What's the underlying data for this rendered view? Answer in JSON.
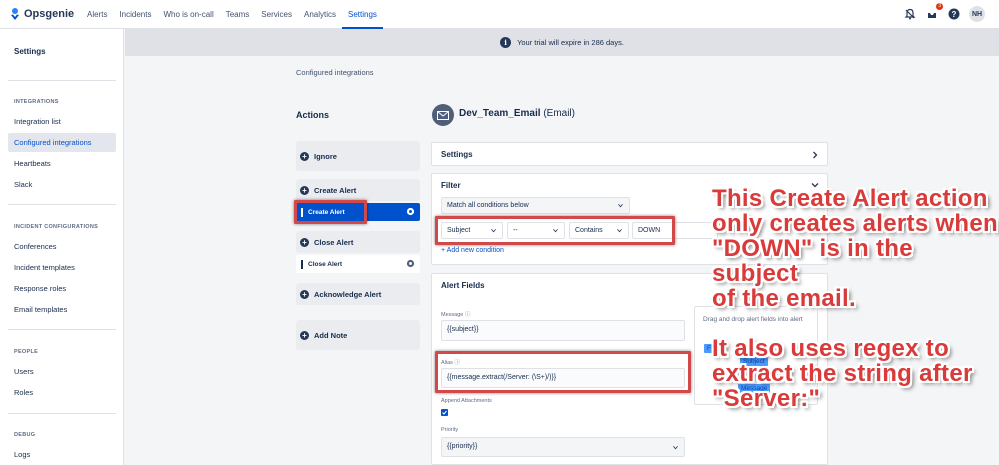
{
  "app": {
    "name": "Opsgenie",
    "brand_color": "#0052cc"
  },
  "nav": [
    "Alerts",
    "Incidents",
    "Who is on-call",
    "Teams",
    "Services",
    "Analytics",
    "Settings"
  ],
  "nav_active": "Settings",
  "topbar": {
    "notification_count": "3",
    "avatar_initials": "NH"
  },
  "sidebar": {
    "title": "Settings",
    "sections": [
      {
        "heading": "INTEGRATIONS",
        "items": [
          "Integration list",
          "Configured integrations",
          "Heartbeats",
          "Slack"
        ]
      },
      {
        "heading": "INCIDENT CONFIGURATIONS",
        "items": [
          "Conferences",
          "Incident templates",
          "Response roles",
          "Email templates"
        ]
      },
      {
        "heading": "PEOPLE",
        "items": [
          "Users",
          "Roles"
        ]
      },
      {
        "heading": "DEBUG",
        "items": [
          "Logs"
        ]
      }
    ],
    "active_item": "Configured integrations"
  },
  "banner": {
    "text": "Your trial will expire in 286 days."
  },
  "breadcrumb": "Configured integrations",
  "actions": {
    "title": "Actions",
    "ignore": "Ignore",
    "create_alert": "Create Alert",
    "create_alert_rule": "Create Alert",
    "close_alert": "Close Alert",
    "close_alert_rule": "Close Alert",
    "acknowledge_alert": "Acknowledge Alert",
    "add_note": "Add Note"
  },
  "integration": {
    "name": "Dev_Team_Email",
    "type": "(Email)"
  },
  "settings_panel": {
    "title": "Settings"
  },
  "filter": {
    "title": "Filter",
    "match": "Match all conditions below",
    "field": "Subject",
    "negate": "--",
    "operator": "Contains",
    "value": "DOWN",
    "add_condition": "+ Add new condition"
  },
  "alert_fields": {
    "title": "Alert Fields",
    "message_label": "Message",
    "message_value": "{{subject}}",
    "alias_label": "Alias",
    "alias_value": "{{message.extract(/Server: (\\S+)/)}}",
    "append_attachments_label": "Append Attachments",
    "priority_label": "Priority",
    "priority_value": "{{priority}}",
    "dnd_help": "Drag and drop alert fields into alert",
    "dnd_chips": [
      "F",
      "Subject",
      "Message"
    ]
  },
  "annotations": {
    "top": [
      "This Create Alert action",
      "only creates alerts when",
      "\"DOWN\" is in the subject",
      "of the email."
    ],
    "bottom": [
      "It also uses regex to",
      "extract the string after",
      "\"Server:\""
    ],
    "color": "#d93a3a"
  }
}
